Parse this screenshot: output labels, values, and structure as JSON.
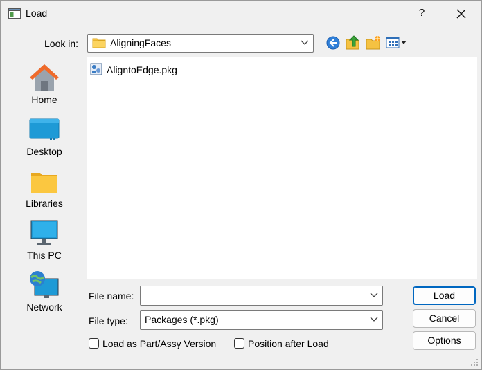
{
  "window": {
    "title": "Load",
    "help_label": "?"
  },
  "toolbar": {
    "look_in_label": "Look in:",
    "look_in_value": "AligningFaces"
  },
  "places": [
    {
      "label": "Home",
      "icon": "home-icon"
    },
    {
      "label": "Desktop",
      "icon": "desktop-icon"
    },
    {
      "label": "Libraries",
      "icon": "libraries-icon"
    },
    {
      "label": "This PC",
      "icon": "this-pc-icon"
    },
    {
      "label": "Network",
      "icon": "network-icon"
    }
  ],
  "files": [
    {
      "name": "AligntoEdge.pkg",
      "icon": "package-file-icon"
    }
  ],
  "form": {
    "file_name_label": "File name:",
    "file_name_value": "",
    "file_type_label": "File type:",
    "file_type_value": "Packages (*.pkg)",
    "load_as_part_label": "Load as Part/Assy Version",
    "position_after_load_label": "Position after Load"
  },
  "buttons": {
    "load": "Load",
    "cancel": "Cancel",
    "options": "Options"
  },
  "colors": {
    "accent": "#0067c0",
    "folder": "#f5c242",
    "window_bg": "#f0f0f0"
  }
}
